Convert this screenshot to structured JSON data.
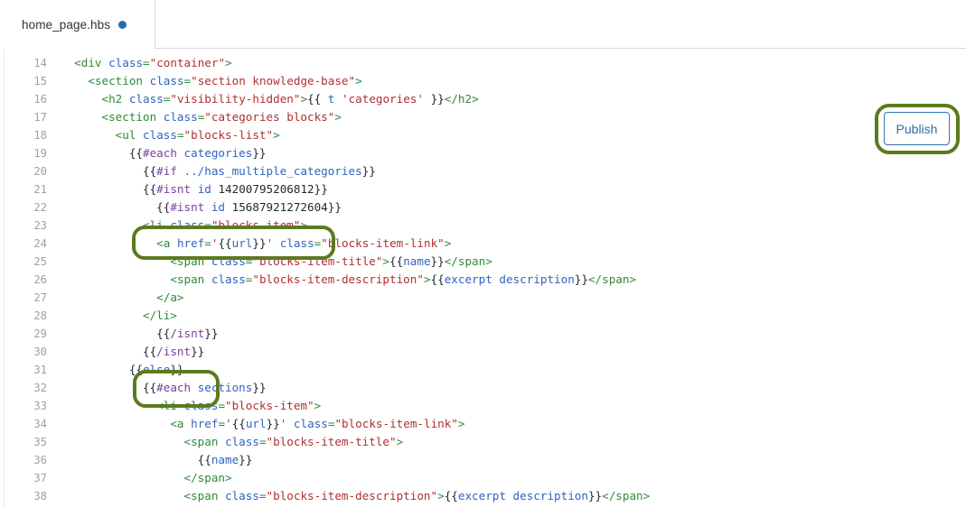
{
  "window": {
    "title": "home_page.hbs"
  },
  "tabbar": {
    "tabs": [
      {
        "label": "home_page.hbs",
        "modified_indicator": "modified-dot",
        "modified_color": "#1f6fb2"
      }
    ]
  },
  "toolbar": {
    "publish_label": "Publish",
    "publish_border_color": "#3572b0",
    "publish_text_color": "#2f6aa8"
  },
  "annotations": {
    "highlight_color": "#5c7a1e",
    "boxes": [
      {
        "name": "isnt-open-tags",
        "target_lines": [
          21,
          22
        ]
      },
      {
        "name": "isnt-close-tags",
        "target_lines": [
          29,
          30
        ]
      },
      {
        "name": "publish-button",
        "target": "publish-button"
      }
    ]
  },
  "editor": {
    "language": "handlebars",
    "first_line_number": 14,
    "colors": {
      "tag": "#2e8b36",
      "attribute": "#2f63bf",
      "string": "#b03030",
      "handlebars_block": "#7b3f9d",
      "identifier": "#2f63bf",
      "punctuation": "#24292e",
      "line_number": "#9aa2a8"
    },
    "lines": [
      {
        "n": "14",
        "text": "  <div class=\"container\">"
      },
      {
        "n": "15",
        "text": "    <section class=\"section knowledge-base\">"
      },
      {
        "n": "16",
        "text": "      <h2 class=\"visibility-hidden\">{{ t 'categories' }}</h2>"
      },
      {
        "n": "17",
        "text": "      <section class=\"categories blocks\">"
      },
      {
        "n": "18",
        "text": "        <ul class=\"blocks-list\">"
      },
      {
        "n": "19",
        "text": "          {{#each categories}}"
      },
      {
        "n": "20",
        "text": "            {{#if ../has_multiple_categories}}"
      },
      {
        "n": "21",
        "text": "            {{#isnt id 14200795206812}}"
      },
      {
        "n": "22",
        "text": "              {{#isnt id 15687921272604}}"
      },
      {
        "n": "23",
        "text": "            <li class=\"blocks-item\">"
      },
      {
        "n": "24",
        "text": "              <a href='{{url}}' class=\"blocks-item-link\">"
      },
      {
        "n": "25",
        "text": "                <span class=\"blocks-item-title\">{{name}}</span>"
      },
      {
        "n": "26",
        "text": "                <span class=\"blocks-item-description\">{{excerpt description}}</span>"
      },
      {
        "n": "27",
        "text": "              </a>"
      },
      {
        "n": "28",
        "text": "            </li>"
      },
      {
        "n": "29",
        "text": "              {{/isnt}}"
      },
      {
        "n": "30",
        "text": "            {{/isnt}}"
      },
      {
        "n": "31",
        "text": "          {{else}}"
      },
      {
        "n": "32",
        "text": "            {{#each sections}}"
      },
      {
        "n": "33",
        "text": "              <li class=\"blocks-item\">"
      },
      {
        "n": "34",
        "text": "                <a href='{{url}}' class=\"blocks-item-link\">"
      },
      {
        "n": "35",
        "text": "                  <span class=\"blocks-item-title\">"
      },
      {
        "n": "36",
        "text": "                    {{name}}"
      },
      {
        "n": "37",
        "text": "                  </span>"
      },
      {
        "n": "38",
        "text": "                  <span class=\"blocks-item-description\">{{excerpt description}}</span>"
      }
    ]
  }
}
